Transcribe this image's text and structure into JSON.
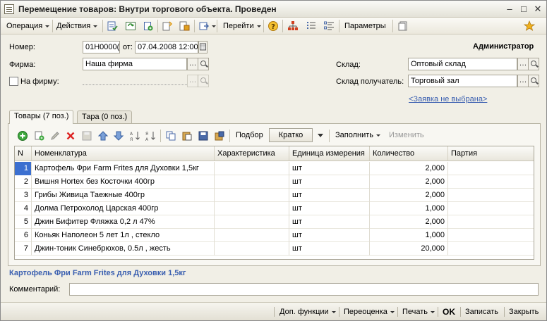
{
  "window": {
    "title": "Перемещение товаров: Внутри торгового объекта. Проведен"
  },
  "toolbar": {
    "operation_label": "Операция",
    "actions_label": "Действия",
    "goto_label": "Перейти",
    "params_label": "Параметры"
  },
  "header": {
    "user": "Администратор",
    "number_label": "Номер:",
    "number_value": "01Н0000(",
    "from_label": "от:",
    "date_value": "07.04.2008 12:00",
    "firm_label": "Фирма:",
    "firm_value": "Наша фирма",
    "to_firm_label": "На фирму:",
    "warehouse_label": "Склад:",
    "warehouse_value": "Оптовый склад",
    "dest_warehouse_label": "Склад получатель:",
    "dest_warehouse_value": "Торговый зал",
    "request_link": "<Заявка не выбрана>"
  },
  "tabs": [
    {
      "label": "Товары (7 поз.)",
      "active": true
    },
    {
      "label": "Тара (0 поз.)",
      "active": false
    }
  ],
  "grid_toolbar": {
    "selection_label": "Подбор",
    "mode_value": "Кратко",
    "fill_label": "Заполнить",
    "change_label": "Изменить"
  },
  "grid": {
    "columns": [
      "N",
      "Номенклатура",
      "Характеристика",
      "Единица измерения",
      "Количество",
      "Партия"
    ],
    "rows": [
      {
        "n": "1",
        "name": "Картофель Фри Farm Frites для Духовки  1,5кг",
        "char": "",
        "unit": "шт",
        "qty": "2,000",
        "batch": ""
      },
      {
        "n": "2",
        "name": "Вишня Hortex без Косточки 400гр",
        "char": "",
        "unit": "шт",
        "qty": "2,000",
        "batch": ""
      },
      {
        "n": "3",
        "name": "Грибы Живица Таежные 400гр",
        "char": "",
        "unit": "шт",
        "qty": "2,000",
        "batch": ""
      },
      {
        "n": "4",
        "name": "Долма Петрохолод Царская 400гр",
        "char": "",
        "unit": "шт",
        "qty": "1,000",
        "batch": ""
      },
      {
        "n": "5",
        "name": "Джин Бифитер Фляжка 0,2 л 47%",
        "char": "",
        "unit": "шт",
        "qty": "2,000",
        "batch": ""
      },
      {
        "n": "6",
        "name": "Коньяк  Наполеон 5 лет 1л , стекло",
        "char": "",
        "unit": "шт",
        "qty": "1,000",
        "batch": ""
      },
      {
        "n": "7",
        "name": "Джин-тоник Синебрюхов, 0.5л , жесть",
        "char": "",
        "unit": "шт",
        "qty": "20,000",
        "batch": ""
      }
    ]
  },
  "footer": {
    "selected_item": "Картофель Фри Farm Frites для Духовки  1,5кг",
    "comment_label": "Комментарий:",
    "comment_value": ""
  },
  "bottom_bar": {
    "extra_functions": "Доп. функции",
    "reprice": "Переоценка",
    "print": "Печать",
    "ok": "OK",
    "save": "Записать",
    "close": "Закрыть"
  },
  "colors": {
    "accent_link": "#3a5fb0",
    "selected_row": "#3b6fd0"
  }
}
